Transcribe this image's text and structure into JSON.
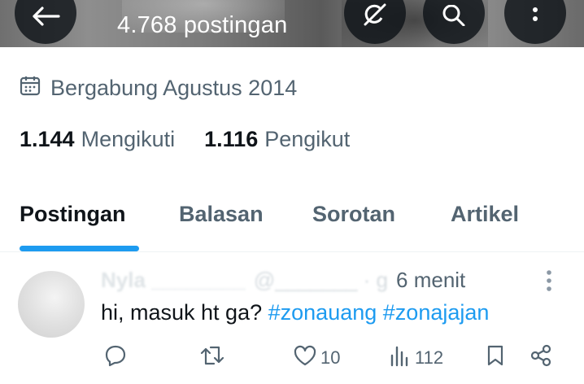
{
  "header": {
    "post_count": "4.768 postingan",
    "icons": [
      "back-arrow-icon",
      "grok-icon",
      "search-icon",
      "more-vertical-icon"
    ]
  },
  "profile": {
    "joined": "Bergabung Agustus 2014",
    "following_count": "1.144",
    "following_label": "Mengikuti",
    "followers_count": "1.116",
    "followers_label": "Pengikut"
  },
  "tabs": [
    {
      "label": "Postingan",
      "active": true
    },
    {
      "label": "Balasan",
      "active": false
    },
    {
      "label": "Sorotan",
      "active": false
    },
    {
      "label": "Artikel",
      "active": false
    }
  ],
  "tweet": {
    "time": "6 menit",
    "text_prefix": "hi, masuk ht ga? ",
    "hashtags": [
      "#zonauang",
      "#zonajajan"
    ],
    "likes": "10",
    "views": "112"
  },
  "colors": {
    "accent": "#1d9bf0",
    "text_primary": "#0f1419",
    "text_secondary": "#536471"
  }
}
